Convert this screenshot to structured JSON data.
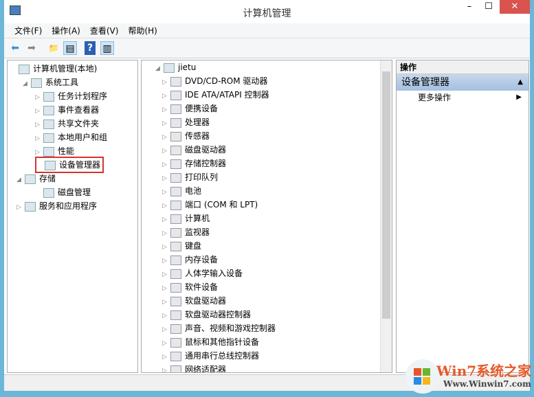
{
  "window": {
    "title": "计算机管理",
    "minimize": "–",
    "maximize": "☐",
    "close": "✕",
    "close_color": "#d9534f"
  },
  "menu": [
    "文件(F)",
    "操作(A)",
    "查看(V)",
    "帮助(H)"
  ],
  "toolbar": {
    "back": "⬅",
    "forward": "➡",
    "up": "📁",
    "console": "▤",
    "help": "?",
    "action_pane": "▥"
  },
  "left_tree": [
    {
      "label": "计算机管理(本地)",
      "level": 0,
      "exp": "",
      "icon": "computer-icon"
    },
    {
      "label": "系统工具",
      "level": 1,
      "exp": "◢",
      "icon": "tools-icon"
    },
    {
      "label": "任务计划程序",
      "level": 2,
      "exp": "▷",
      "icon": "clock-icon"
    },
    {
      "label": "事件查看器",
      "level": 2,
      "exp": "▷",
      "icon": "event-viewer-icon"
    },
    {
      "label": "共享文件夹",
      "level": 2,
      "exp": "▷",
      "icon": "shared-folder-icon"
    },
    {
      "label": "本地用户和组",
      "level": 2,
      "exp": "▷",
      "icon": "users-icon"
    },
    {
      "label": "性能",
      "level": 2,
      "exp": "▷",
      "icon": "performance-icon"
    },
    {
      "label": "设备管理器",
      "level": 2,
      "exp": "",
      "icon": "device-manager-icon",
      "selected": true
    },
    {
      "label": "存储",
      "level": 0.5,
      "exp": "◢",
      "icon": "storage-icon"
    },
    {
      "label": "磁盘管理",
      "level": 2,
      "exp": "",
      "icon": "disk-icon"
    },
    {
      "label": "服务和应用程序",
      "level": 0.5,
      "exp": "▷",
      "icon": "services-icon"
    }
  ],
  "device_tree": {
    "root": "jietu",
    "items": [
      "DVD/CD-ROM 驱动器",
      "IDE ATA/ATAPI 控制器",
      "便携设备",
      "处理器",
      "传感器",
      "磁盘驱动器",
      "存储控制器",
      "打印队列",
      "电池",
      "端口 (COM 和 LPT)",
      "计算机",
      "监视器",
      "键盘",
      "内存设备",
      "人体学输入设备",
      "软件设备",
      "软盘驱动器",
      "软盘驱动器控制器",
      "声音、视频和游戏控制器",
      "鼠标和其他指针设备",
      "通用串行总线控制器",
      "网络适配器"
    ]
  },
  "actions": {
    "header": "操作",
    "section": "设备管理器",
    "more": "更多操作"
  },
  "watermark": {
    "brand": "Win7系统之家",
    "url": "Www.Winwin7.com"
  }
}
